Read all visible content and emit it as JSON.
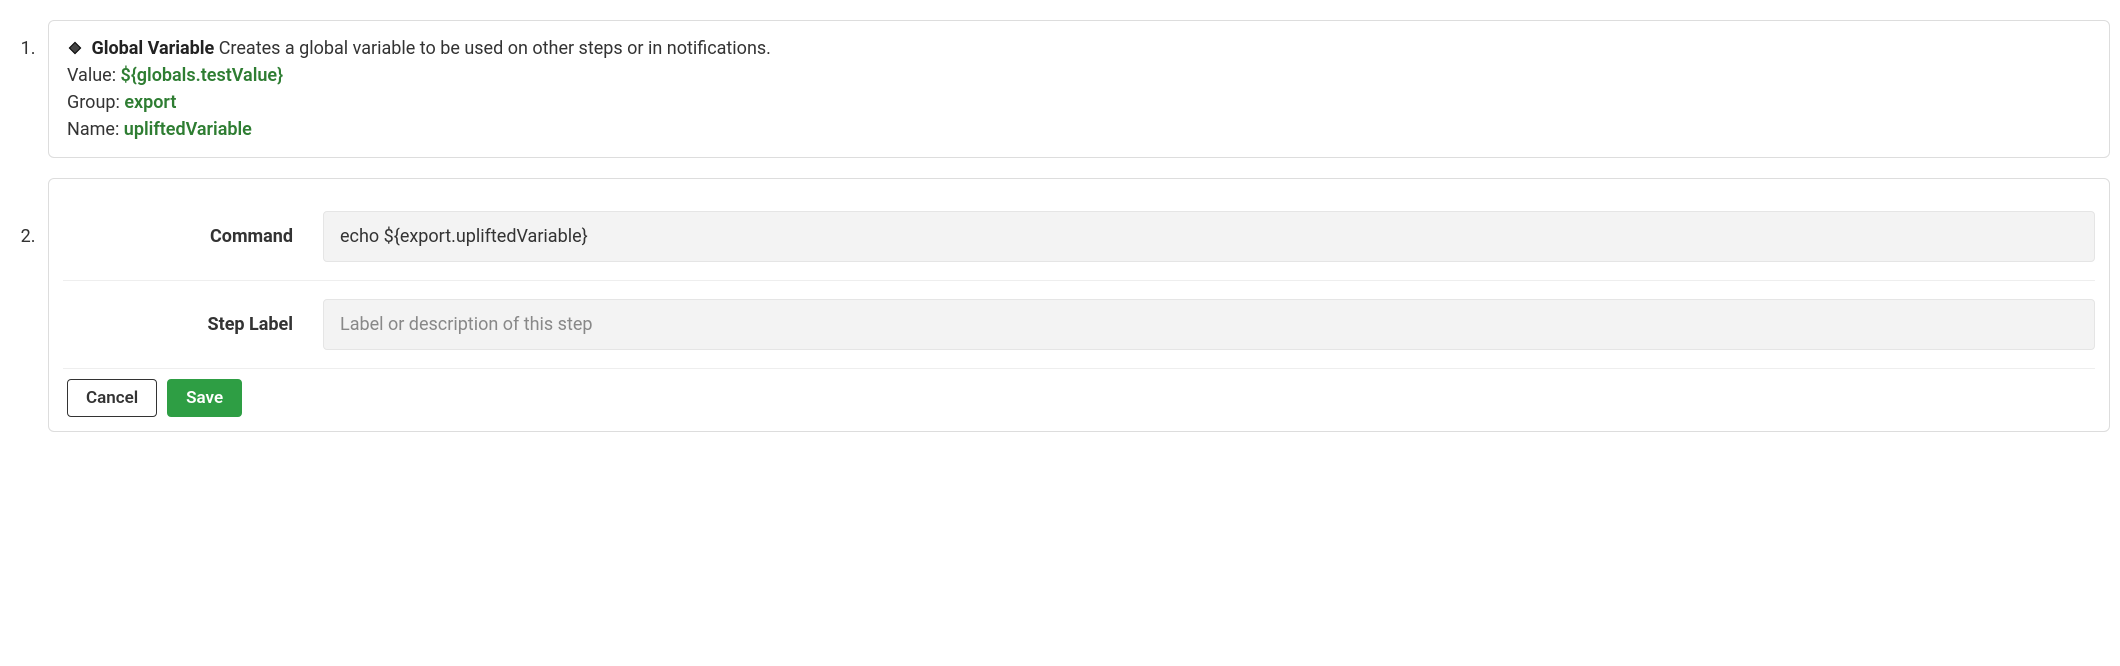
{
  "steps": [
    {
      "badge": "diamond",
      "title": "Global Variable",
      "description": "Creates a global variable to be used on other steps or in notifications.",
      "fields": [
        {
          "label": "Value:",
          "value": "${globals.testValue}"
        },
        {
          "label": "Group:",
          "value": "export"
        },
        {
          "label": "Name:",
          "value": "upliftedVariable"
        }
      ]
    }
  ],
  "editor": {
    "command": {
      "label": "Command",
      "value": "echo ${export.upliftedVariable}"
    },
    "stepLabel": {
      "label": "Step Label",
      "placeholder": "Label or description of this step",
      "value": ""
    },
    "buttons": {
      "cancel": "Cancel",
      "save": "Save"
    }
  }
}
